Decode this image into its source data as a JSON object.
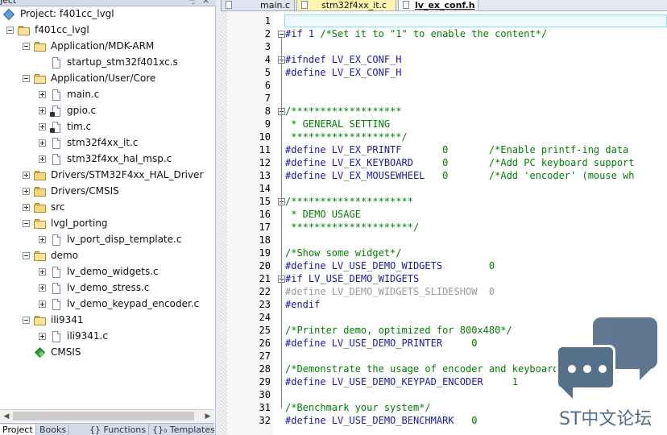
{
  "project_pane": {
    "title": "ject",
    "pin_glyph": "−̱",
    "close_glyph": "×",
    "tree": [
      {
        "label": "Project: f401cc_lvgl",
        "icon": "target",
        "indent": 0,
        "expander": "none"
      },
      {
        "label": "f401cc_lvgl",
        "icon": "folder-open",
        "indent": 1,
        "expander": "minus"
      },
      {
        "label": "Application/MDK-ARM",
        "icon": "folder-open",
        "indent": 2,
        "expander": "minus"
      },
      {
        "label": "startup_stm32f401xc.s",
        "icon": "file",
        "indent": 3,
        "expander": "none"
      },
      {
        "label": "Application/User/Core",
        "icon": "folder-open",
        "indent": 2,
        "expander": "minus"
      },
      {
        "label": "main.c",
        "icon": "file",
        "indent": 3,
        "expander": "plus"
      },
      {
        "label": "gpio.c",
        "icon": "file-key",
        "indent": 3,
        "expander": "plus"
      },
      {
        "label": "tim.c",
        "icon": "file-key",
        "indent": 3,
        "expander": "plus"
      },
      {
        "label": "stm32f4xx_it.c",
        "icon": "file",
        "indent": 3,
        "expander": "plus"
      },
      {
        "label": "stm32f4xx_hal_msp.c",
        "icon": "file",
        "indent": 3,
        "expander": "plus"
      },
      {
        "label": "Drivers/STM32F4xx_HAL_Driver",
        "icon": "folder",
        "indent": 2,
        "expander": "plus"
      },
      {
        "label": "Drivers/CMSIS",
        "icon": "folder",
        "indent": 2,
        "expander": "plus"
      },
      {
        "label": "src",
        "icon": "folder",
        "indent": 2,
        "expander": "plus"
      },
      {
        "label": "lvgl_porting",
        "icon": "folder-open",
        "indent": 2,
        "expander": "minus"
      },
      {
        "label": "lv_port_disp_template.c",
        "icon": "file",
        "indent": 3,
        "expander": "plus"
      },
      {
        "label": "demo",
        "icon": "folder-open",
        "indent": 2,
        "expander": "minus"
      },
      {
        "label": "lv_demo_widgets.c",
        "icon": "file",
        "indent": 3,
        "expander": "plus"
      },
      {
        "label": "lv_demo_stress.c",
        "icon": "file",
        "indent": 3,
        "expander": "plus"
      },
      {
        "label": "lv_demo_keypad_encoder.c",
        "icon": "file",
        "indent": 3,
        "expander": "plus"
      },
      {
        "label": "ili9341",
        "icon": "folder-open",
        "indent": 2,
        "expander": "minus"
      },
      {
        "label": "ili9341.c",
        "icon": "file",
        "indent": 3,
        "expander": "plus"
      },
      {
        "label": "CMSIS",
        "icon": "gem",
        "indent": 2,
        "expander": "none"
      }
    ],
    "bottom_tabs": [
      "Project",
      "Books",
      "{} Functions",
      "{}₀ Templates"
    ]
  },
  "editor": {
    "tabs": [
      {
        "label": "main.c",
        "style": "normal"
      },
      {
        "label": "stm32f4xx_it.c",
        "style": "yellow"
      },
      {
        "label": "lv_ex_conf.h",
        "style": "active"
      }
    ],
    "lines": [
      {
        "n": "1",
        "fold": "",
        "segs": []
      },
      {
        "n": "2",
        "fold": "start",
        "segs": [
          {
            "t": "#if 1 ",
            "c": "pp"
          },
          {
            "t": "/*Set it to \"1\" to enable the content*/",
            "c": "cm"
          }
        ]
      },
      {
        "n": "3",
        "fold": "",
        "segs": []
      },
      {
        "n": "4",
        "fold": "start",
        "segs": [
          {
            "t": "#ifndef LV_EX_CONF_H",
            "c": "pp"
          }
        ]
      },
      {
        "n": "5",
        "fold": "",
        "segs": [
          {
            "t": "#define LV_EX_CONF_H",
            "c": "pp"
          }
        ]
      },
      {
        "n": "6",
        "fold": "",
        "segs": []
      },
      {
        "n": "7",
        "fold": "",
        "segs": []
      },
      {
        "n": "8",
        "fold": "start",
        "segs": [
          {
            "t": "/*******************",
            "c": "cm"
          }
        ]
      },
      {
        "n": "9",
        "fold": "",
        "segs": [
          {
            "t": " * GENERAL SETTING",
            "c": "cm"
          }
        ]
      },
      {
        "n": "10",
        "fold": "",
        "segs": [
          {
            "t": " *******************/",
            "c": "cm"
          }
        ]
      },
      {
        "n": "11",
        "fold": "",
        "segs": [
          {
            "t": "#define LV_EX_PRINTF       ",
            "c": "pp"
          },
          {
            "t": "0",
            "c": "num"
          },
          {
            "t": "       ",
            "c": "pp"
          },
          {
            "t": "/*Enable printf-ing data",
            "c": "cm"
          }
        ]
      },
      {
        "n": "12",
        "fold": "",
        "segs": [
          {
            "t": "#define LV_EX_KEYBOARD     ",
            "c": "pp"
          },
          {
            "t": "0",
            "c": "num"
          },
          {
            "t": "       ",
            "c": "pp"
          },
          {
            "t": "/*Add PC keyboard support",
            "c": "cm"
          }
        ]
      },
      {
        "n": "13",
        "fold": "",
        "segs": [
          {
            "t": "#define LV_EX_MOUSEWHEEL   ",
            "c": "pp"
          },
          {
            "t": "0",
            "c": "num"
          },
          {
            "t": "       ",
            "c": "pp"
          },
          {
            "t": "/*Add 'encoder' (mouse wh",
            "c": "cm"
          }
        ]
      },
      {
        "n": "14",
        "fold": "",
        "segs": []
      },
      {
        "n": "15",
        "fold": "start",
        "segs": [
          {
            "t": "/*********************",
            "c": "cm"
          }
        ]
      },
      {
        "n": "16",
        "fold": "",
        "segs": [
          {
            "t": " * DEMO USAGE",
            "c": "cm"
          }
        ]
      },
      {
        "n": "17",
        "fold": "",
        "segs": [
          {
            "t": " *********************/",
            "c": "cm"
          }
        ]
      },
      {
        "n": "18",
        "fold": "",
        "segs": []
      },
      {
        "n": "19",
        "fold": "",
        "segs": [
          {
            "t": "/*Show some widget*/",
            "c": "cm"
          }
        ]
      },
      {
        "n": "20",
        "fold": "",
        "segs": [
          {
            "t": "#define LV_USE_DEMO_WIDGETS        ",
            "c": "pp"
          },
          {
            "t": "0",
            "c": "num"
          }
        ]
      },
      {
        "n": "21",
        "fold": "start",
        "segs": [
          {
            "t": "#if LV_USE_DEMO_WIDGETS",
            "c": "pp"
          }
        ]
      },
      {
        "n": "22",
        "fold": "",
        "segs": [
          {
            "t": "#define LV_DEMO_WIDGETS_SLIDESHOW  0",
            "c": "dis"
          }
        ]
      },
      {
        "n": "23",
        "fold": "",
        "segs": [
          {
            "t": "#endif",
            "c": "pp"
          }
        ]
      },
      {
        "n": "24",
        "fold": "",
        "segs": []
      },
      {
        "n": "25",
        "fold": "",
        "segs": [
          {
            "t": "/*Printer demo, optimized for 800x480*/",
            "c": "cm"
          }
        ]
      },
      {
        "n": "26",
        "fold": "",
        "segs": [
          {
            "t": "#define LV_USE_DEMO_PRINTER     ",
            "c": "pp"
          },
          {
            "t": "0",
            "c": "num"
          }
        ]
      },
      {
        "n": "27",
        "fold": "",
        "segs": []
      },
      {
        "n": "28",
        "fold": "",
        "segs": [
          {
            "t": "/*Demonstrate the usage of encoder and keyboard*/",
            "c": "cm"
          }
        ]
      },
      {
        "n": "29",
        "fold": "",
        "segs": [
          {
            "t": "#define LV_USE_DEMO_KEYPAD_ENCODER     ",
            "c": "pp"
          },
          {
            "t": "1",
            "c": "num"
          }
        ]
      },
      {
        "n": "30",
        "fold": "",
        "segs": []
      },
      {
        "n": "31",
        "fold": "",
        "segs": [
          {
            "t": "/*Benchmark your system*/",
            "c": "cm"
          }
        ]
      },
      {
        "n": "32",
        "fold": "",
        "segs": [
          {
            "t": "#define LV_USE_DEMO_BENCHMARK   ",
            "c": "pp"
          },
          {
            "t": "0",
            "c": "num"
          }
        ]
      }
    ]
  },
  "watermark": {
    "text": "ST中文论坛"
  },
  "colors": {
    "preprocessor": "#1a1aa6",
    "comment": "#008000",
    "number": "#008000",
    "disabled": "#9a9a9a",
    "current_line_border": "#8fd7f7",
    "tab_yellow": "#fff3b0",
    "watermark": "#56708a"
  }
}
